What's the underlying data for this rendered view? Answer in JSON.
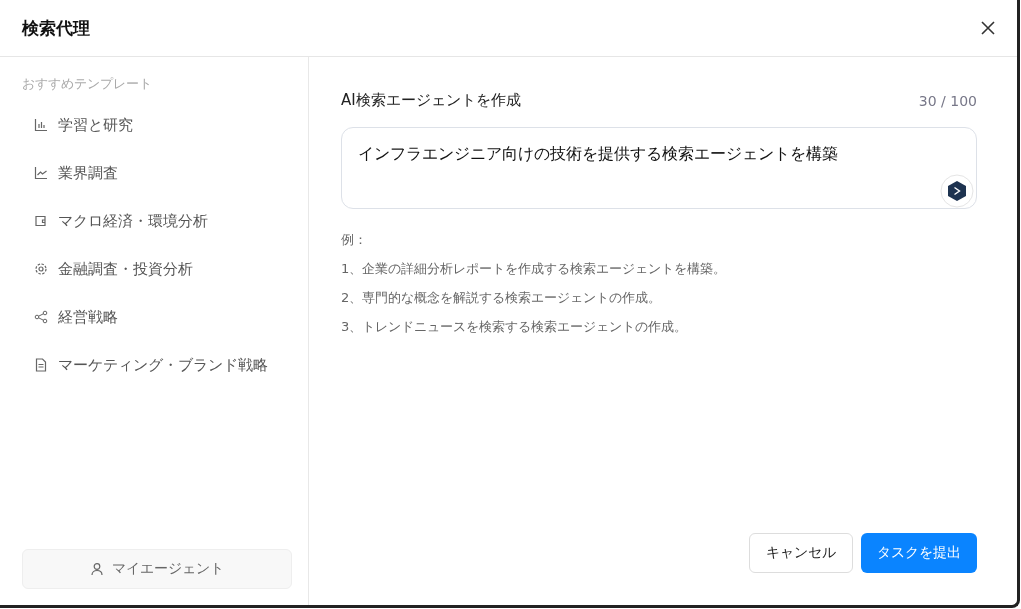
{
  "dialog": {
    "title": "検索代理"
  },
  "sidebar": {
    "heading": "おすすめテンプレート",
    "items": [
      {
        "label": "学習と研究",
        "kind": "bars"
      },
      {
        "label": "業界調査",
        "kind": "line"
      },
      {
        "label": "マクロ経済・環境分析",
        "kind": "wallet"
      },
      {
        "label": "金融調査・投資分析",
        "kind": "gear"
      },
      {
        "label": "経営戦略",
        "kind": "share"
      },
      {
        "label": "マーケティング・ブランド戦略",
        "kind": "document"
      }
    ],
    "my_agents": "マイエージェント"
  },
  "form": {
    "label": "AI検索エージェントを作成",
    "counter": "30 / 100",
    "value": "インフラエンジニア向けの技術を提供する検索エージェントを構築"
  },
  "examples": {
    "heading": "例：",
    "items": [
      "1、企業の詳細分析レポートを作成する検索エージェントを構築。",
      "2、専門的な概念を解説する検索エージェントの作成。",
      "3、トレンドニュースを検索する検索エージェントの作成。"
    ]
  },
  "buttons": {
    "cancel": "キャンセル",
    "submit": "タスクを提出"
  }
}
